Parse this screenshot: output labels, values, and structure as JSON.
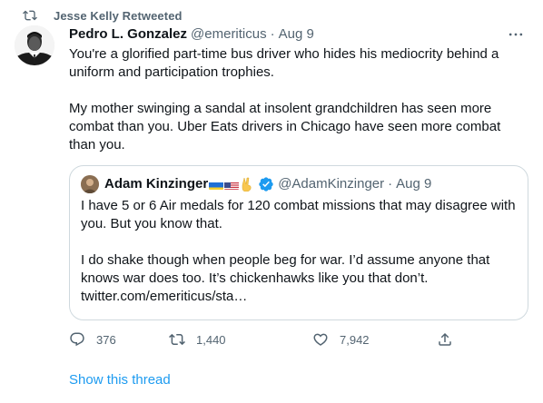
{
  "retweet_context": {
    "icon": "retweet-icon",
    "text": "Jesse Kelly Retweeted"
  },
  "tweet": {
    "display_name": "Pedro L. Gonzalez",
    "handle": "@emeriticus",
    "separator": "·",
    "date": "Aug 9",
    "more_icon": "more-horizontal-icon",
    "paragraphs": [
      "You're a glorified part-time bus driver who hides his mediocrity behind a uniform and participation trophies.",
      "My mother swinging a sandal at insolent grandchildren has seen more combat than you. Uber Eats drivers in Chicago have seen more combat than you."
    ]
  },
  "quoted_tweet": {
    "display_name": "Adam Kinzinger",
    "emojis": [
      "ukraine-flag",
      "us-flag",
      "victory-hand"
    ],
    "verified_icon": "verified-badge-icon",
    "handle": "@AdamKinzinger",
    "separator": "·",
    "date": "Aug 9",
    "paragraphs": [
      "I have 5 or 6 Air medals for 120 combat missions that may disagree with you. But you know that.",
      "I do shake though when people beg for war.  I’d assume anyone that knows war does too.  It’s chickenhawks like you that don’t. twitter.com/emeriticus/sta…"
    ]
  },
  "actions": {
    "reply_count": "376",
    "retweet_count": "1,440",
    "like_count": "7,942",
    "share_icon": "share-icon"
  },
  "show_thread": "Show this thread",
  "colors": {
    "text": "#0f1419",
    "secondary": "#536471",
    "link": "#1d9bf0",
    "verified": "#1d9bf0",
    "border": "#cfd9de"
  }
}
